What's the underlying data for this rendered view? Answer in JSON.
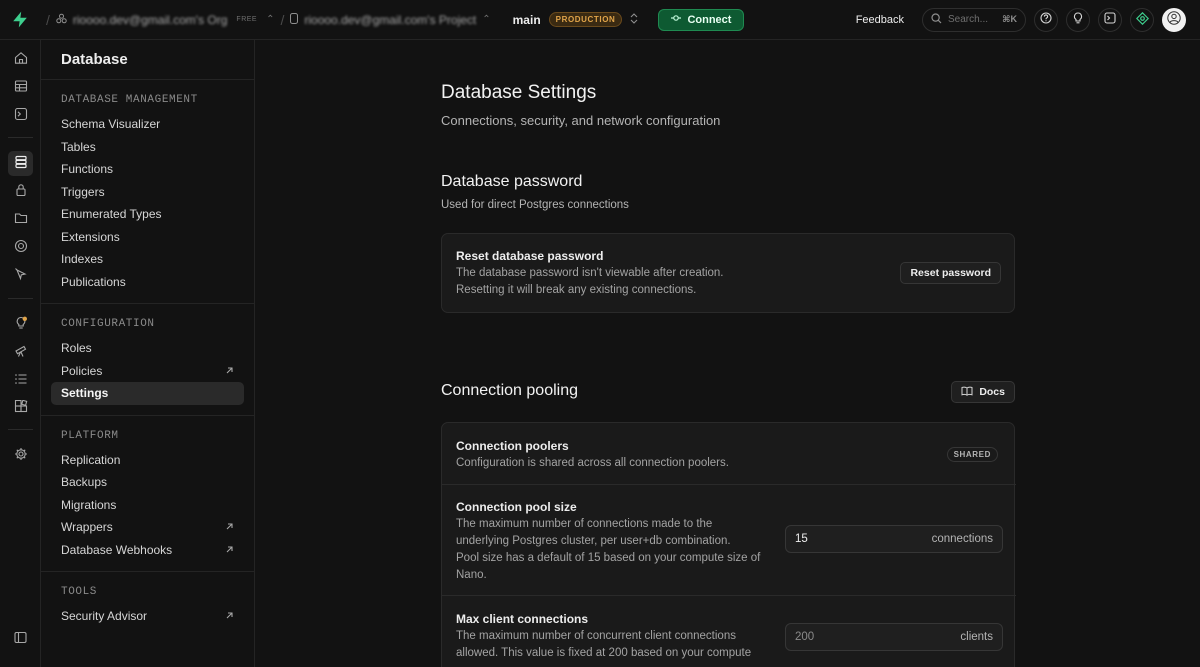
{
  "topbar": {
    "org_name": "rioooo.dev@gmail.com's Org",
    "org_plan": "FREE",
    "project_name": "rioooo.dev@gmail.com's Project",
    "branch_name": "main",
    "branch_badge": "PRODUCTION",
    "connect_label": "Connect",
    "feedback_label": "Feedback",
    "search_placeholder": "Search...",
    "search_shortcut": "⌘K",
    "accent_color": "#3ecf8e"
  },
  "sidebar": {
    "title": "Database",
    "sections": [
      {
        "heading": "DATABASE MANAGEMENT",
        "items": [
          {
            "label": "Schema Visualizer"
          },
          {
            "label": "Tables"
          },
          {
            "label": "Functions"
          },
          {
            "label": "Triggers"
          },
          {
            "label": "Enumerated Types"
          },
          {
            "label": "Extensions"
          },
          {
            "label": "Indexes"
          },
          {
            "label": "Publications"
          }
        ]
      },
      {
        "heading": "CONFIGURATION",
        "items": [
          {
            "label": "Roles"
          },
          {
            "label": "Policies"
          },
          {
            "label": "Settings"
          }
        ]
      },
      {
        "heading": "PLATFORM",
        "items": [
          {
            "label": "Replication"
          },
          {
            "label": "Backups"
          },
          {
            "label": "Migrations"
          },
          {
            "label": "Wrappers"
          },
          {
            "label": "Database Webhooks"
          }
        ]
      },
      {
        "heading": "TOOLS",
        "items": [
          {
            "label": "Security Advisor"
          }
        ]
      }
    ]
  },
  "page": {
    "title": "Database Settings",
    "subtitle": "Connections, security, and network configuration"
  },
  "password_section": {
    "title": "Database password",
    "subtitle": "Used for direct Postgres connections",
    "card_title": "Reset database password",
    "card_desc_1": "The database password isn't viewable after creation.",
    "card_desc_2": "Resetting it will break any existing connections.",
    "reset_button": "Reset password"
  },
  "pooling_section": {
    "title": "Connection pooling",
    "docs_button": "Docs",
    "poolers_title": "Connection poolers",
    "poolers_desc": "Configuration is shared across all connection poolers.",
    "poolers_badge": "SHARED",
    "pool_size_title": "Connection pool size",
    "pool_size_desc": [
      "The maximum number of connections made to the",
      "underlying Postgres cluster, per user+db combination.",
      "Pool size has a default of 15 based on your compute size of",
      "Nano."
    ],
    "pool_size_value": "15",
    "pool_size_unit": "connections",
    "max_client_title": "Max client connections",
    "max_client_desc": [
      "The maximum number of concurrent client connections",
      "allowed. This value is fixed at 200 based on your compute"
    ],
    "max_client_value": "200",
    "max_client_unit": "clients"
  }
}
